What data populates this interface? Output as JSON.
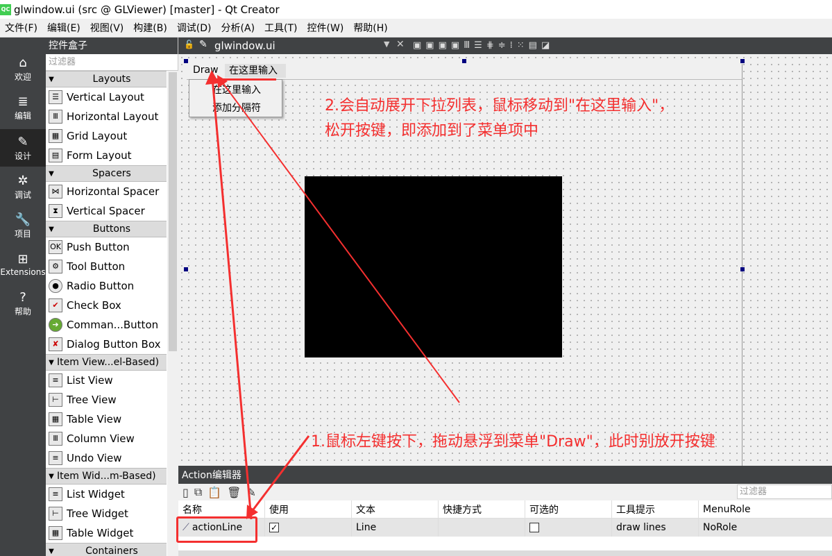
{
  "window": {
    "title": "glwindow.ui (src @ GLViewer) [master] - Qt Creator",
    "icon_text": "QC"
  },
  "menubar": [
    "文件(F)",
    "编辑(E)",
    "视图(V)",
    "构建(B)",
    "调试(D)",
    "分析(A)",
    "工具(T)",
    "控件(W)",
    "帮助(H)"
  ],
  "modes": [
    {
      "label": "欢迎",
      "icon": "⌂"
    },
    {
      "label": "编辑",
      "icon": "≣"
    },
    {
      "label": "设计",
      "icon": "✎"
    },
    {
      "label": "调试",
      "icon": "✲"
    },
    {
      "label": "项目",
      "icon": "🔧"
    },
    {
      "label": "Extensions",
      "icon": "⊞"
    },
    {
      "label": "帮助",
      "icon": "?"
    }
  ],
  "widget_box": {
    "title": "控件盒子",
    "filter_placeholder": "过滤器",
    "categories": [
      {
        "label": "Layouts",
        "items": [
          "Vertical Layout",
          "Horizontal Layout",
          "Grid Layout",
          "Form Layout"
        ]
      },
      {
        "label": "Spacers",
        "items": [
          "Horizontal Spacer",
          "Vertical Spacer"
        ]
      },
      {
        "label": "Buttons",
        "items": [
          "Push Button",
          "Tool Button",
          "Radio Button",
          "Check Box",
          "Comman...Button",
          "Dialog Button Box"
        ]
      },
      {
        "label": "Item View...el-Based)",
        "items": [
          "List View",
          "Tree View",
          "Table View",
          "Column View",
          "Undo View"
        ]
      },
      {
        "label": "Item Wid...m-Based)",
        "items": [
          "List Widget",
          "Tree Widget",
          "Table Widget"
        ]
      },
      {
        "label": "Containers",
        "items": []
      }
    ]
  },
  "editor": {
    "tab_file": "glwindow.ui"
  },
  "form": {
    "menus": [
      "Draw",
      "在这里输入"
    ],
    "dropdown_items": [
      "在这里输入",
      "添加分隔符"
    ]
  },
  "action_editor": {
    "title": "Action编辑器",
    "filter_placeholder": "过滤器",
    "columns": [
      "名称",
      "使用",
      "文本",
      "快捷方式",
      "可选的",
      "工具提示",
      "MenuRole"
    ],
    "rows": [
      {
        "name": "actionLine",
        "used": true,
        "text": "Line",
        "shortcut": "",
        "checkable": false,
        "tooltip": "draw lines",
        "menurole": "NoRole"
      }
    ]
  },
  "annotations": {
    "step2_line1": "2.会自动展开下拉列表，鼠标移动到\"在这里输入\"，",
    "step2_line2": "松开按键，即添加到了菜单项中",
    "step1": "1.鼠标左键按下，拖动悬浮到菜单\"Draw\"，此时别放开按键"
  },
  "colors": {
    "annotation": "#f42f2f",
    "dark_panel": "#404244"
  }
}
